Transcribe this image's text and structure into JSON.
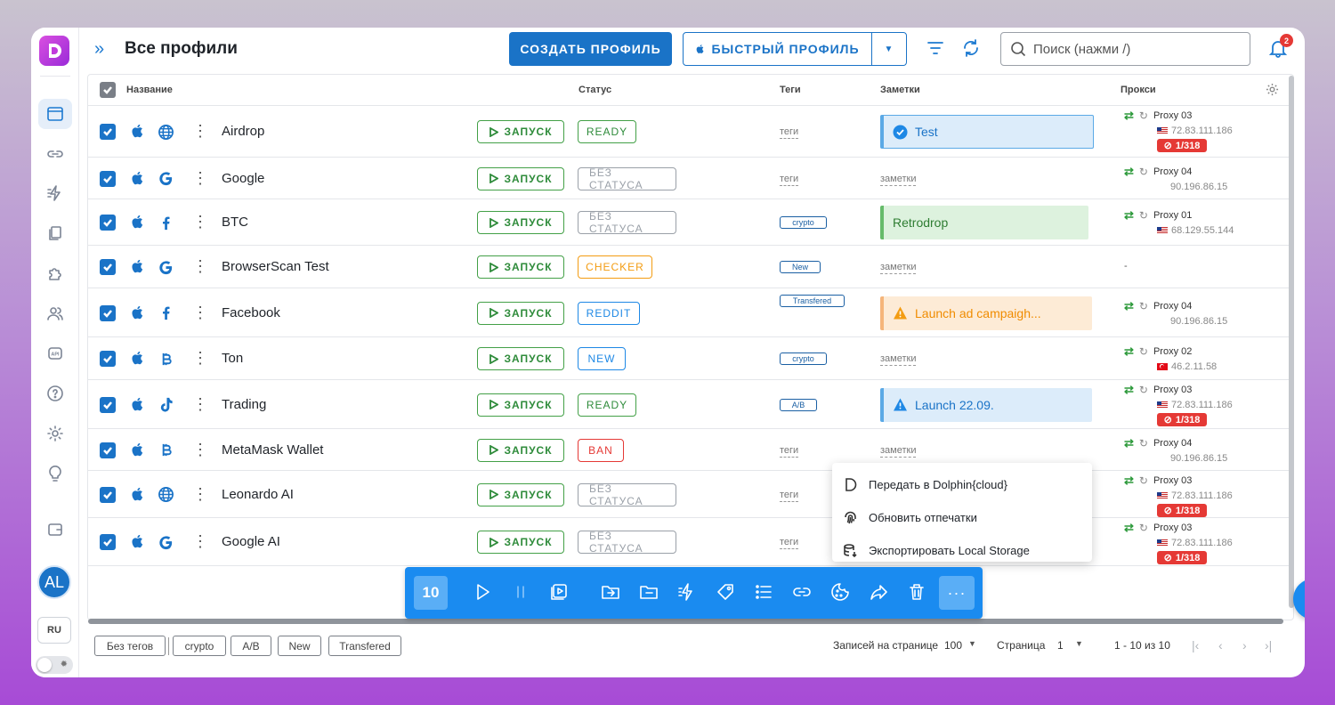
{
  "header": {
    "title": "Все профили",
    "create_button": "СОЗДАТЬ ПРОФИЛЬ",
    "quick_button": "БЫСТРЫЙ ПРОФИЛЬ",
    "search_placeholder": "Поиск (нажми /)",
    "notifications_count": "2"
  },
  "columns": {
    "name": "Название",
    "status": "Статус",
    "tags": "Теги",
    "notes": "Заметки",
    "proxy": "Прокси"
  },
  "launch_label": "ЗАПУСК",
  "rows": [
    {
      "name": "Airdrop",
      "site_icon": "globe-icon",
      "status": "READY",
      "status_color": "#43a047",
      "tag": "теги",
      "tag_is_chip": false,
      "note": "Test",
      "note_style": "blue",
      "proxy_name": "Proxy 03",
      "proxy_ip": "72.83.111.186",
      "proxy_flag": "us",
      "proxy_ban": "1/318"
    },
    {
      "name": "Google",
      "site_icon": "google-icon",
      "status": "БЕЗ СТАТУСА",
      "status_color": "#9aa0a8",
      "tag": "теги",
      "tag_is_chip": false,
      "note": "заметки",
      "note_style": "none",
      "proxy_name": "Proxy 04",
      "proxy_ip": "90.196.86.15",
      "proxy_flag": "",
      "proxy_ban": ""
    },
    {
      "name": "BTC",
      "site_icon": "facebook-icon",
      "status": "БЕЗ СТАТУСА",
      "status_color": "#9aa0a8",
      "tag": "crypto",
      "tag_is_chip": true,
      "note": "Retrodrop",
      "note_style": "green",
      "proxy_name": "Proxy 01",
      "proxy_ip": "68.129.55.144",
      "proxy_flag": "us",
      "proxy_ban": ""
    },
    {
      "name": "BrowserScan Test",
      "site_icon": "google-icon",
      "status": "CHECKER",
      "status_color": "#f39c12",
      "tag": "New",
      "tag_is_chip": true,
      "note": "заметки",
      "note_style": "none",
      "proxy_name": "-",
      "proxy_ip": "",
      "proxy_flag": "",
      "proxy_ban": ""
    },
    {
      "name": "Facebook",
      "site_icon": "facebook-icon",
      "status": "REDDIT",
      "status_color": "#1e88e5",
      "tag": "Transfered",
      "tag_is_chip": true,
      "note": "Launch ad campaigh...",
      "note_style": "orange",
      "proxy_name": "Proxy 04",
      "proxy_ip": "90.196.86.15",
      "proxy_flag": "",
      "proxy_ban": ""
    },
    {
      "name": "Ton",
      "site_icon": "bitcoin-icon",
      "status": "NEW",
      "status_color": "#1e88e5",
      "tag": "crypto",
      "tag_is_chip": true,
      "note": "заметки",
      "note_style": "none",
      "proxy_name": "Proxy 02",
      "proxy_ip": "46.2.11.58",
      "proxy_flag": "tr",
      "proxy_ban": ""
    },
    {
      "name": "Trading",
      "site_icon": "tiktok-icon",
      "status": "READY",
      "status_color": "#43a047",
      "tag": "A/B",
      "tag_is_chip": true,
      "note": "Launch 22.09.",
      "note_style": "blue-warn",
      "proxy_name": "Proxy 03",
      "proxy_ip": "72.83.111.186",
      "proxy_flag": "us",
      "proxy_ban": "1/318"
    },
    {
      "name": "MetaMask Wallet",
      "site_icon": "bitcoin-icon",
      "status": "BAN",
      "status_color": "#e53935",
      "tag": "теги",
      "tag_is_chip": false,
      "note": "заметки",
      "note_style": "none",
      "proxy_name": "Proxy 04",
      "proxy_ip": "90.196.86.15",
      "proxy_flag": "",
      "proxy_ban": ""
    },
    {
      "name": "Leonardo AI",
      "site_icon": "globe-icon",
      "status": "БЕЗ СТАТУСА",
      "status_color": "#9aa0a8",
      "tag": "теги",
      "tag_is_chip": false,
      "note": "",
      "note_style": "none",
      "proxy_name": "Proxy 03",
      "proxy_ip": "72.83.111.186",
      "proxy_flag": "us",
      "proxy_ban": "1/318"
    },
    {
      "name": "Google AI",
      "site_icon": "google-icon",
      "status": "БЕЗ СТАТУСА",
      "status_color": "#9aa0a8",
      "tag": "теги",
      "tag_is_chip": false,
      "note": "",
      "note_style": "none",
      "proxy_name": "Proxy 03",
      "proxy_ip": "72.83.111.186",
      "proxy_flag": "us",
      "proxy_ban": "1/318"
    }
  ],
  "context_menu": {
    "items": [
      "Передать в Dolphin{cloud}",
      "Обновить отпечатки",
      "Экспортировать Local Storage"
    ]
  },
  "bulk_bar": {
    "selected_count": "10",
    "more": "···"
  },
  "sidebar": {
    "avatar": "AL",
    "language": "RU"
  },
  "footer": {
    "tags": [
      "Без тегов",
      "crypto",
      "A/B",
      "New",
      "Transfered"
    ],
    "per_page_label": "Записей на странице",
    "per_page_value": "100",
    "page_label": "Страница",
    "page_value": "1",
    "range": "1 - 10 из 10"
  },
  "colors": {
    "primary": "#1a73c7",
    "bulk_bar": "#1a8bf0",
    "ready": "#43a047",
    "ban": "#e53935",
    "checker": "#f39c12"
  }
}
